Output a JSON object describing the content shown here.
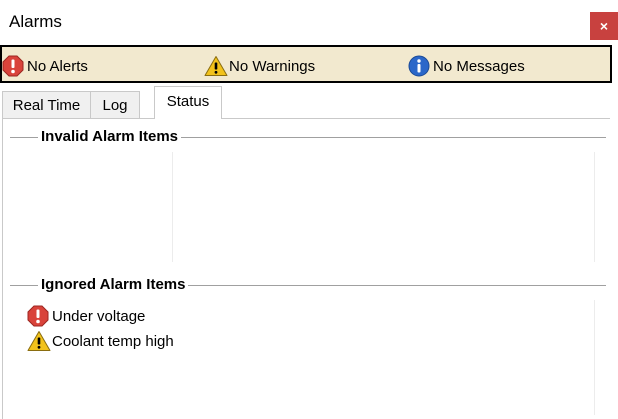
{
  "window": {
    "title": "Alarms",
    "close_label": "×"
  },
  "statusbar": {
    "alerts": "No Alerts",
    "warnings": "No Warnings",
    "messages": "No Messages"
  },
  "tabs": [
    {
      "label": "Real Time",
      "active": false
    },
    {
      "label": "Log",
      "active": false
    },
    {
      "label": "Status",
      "active": true
    }
  ],
  "status_panel": {
    "invalid_title": "Invalid Alarm Items",
    "invalid_items": [],
    "ignored_title": "Ignored Alarm Items",
    "ignored_items": [
      {
        "icon": "error-icon",
        "label": "Under voltage"
      },
      {
        "icon": "warning-icon",
        "label": "Coolant temp high"
      }
    ]
  },
  "colors": {
    "statusbar_bg": "#f2e9cf",
    "close_bg": "#c8413f",
    "error": "#d9433b",
    "warning": "#f2c21b",
    "info": "#2b67c9"
  }
}
